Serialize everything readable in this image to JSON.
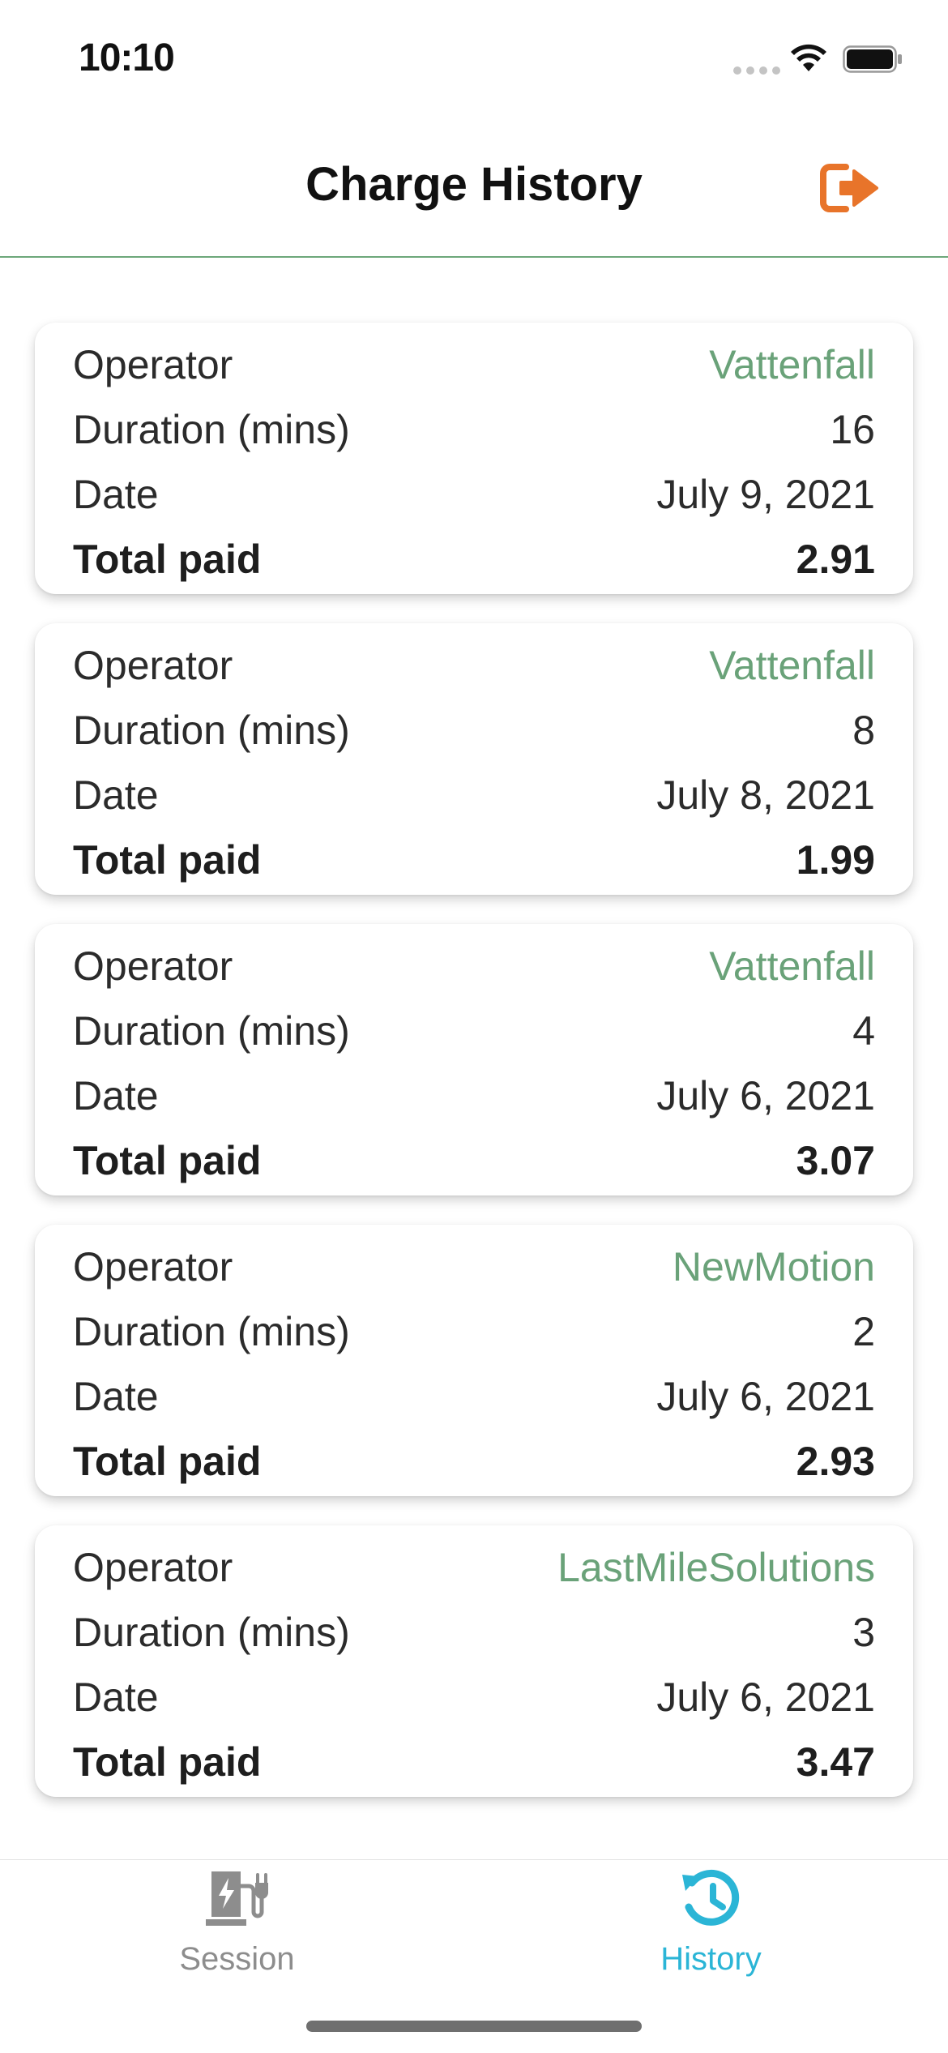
{
  "status_bar": {
    "time": "10:10"
  },
  "header": {
    "title": "Charge History",
    "logout_icon": "logout-icon",
    "accent_color": "#e8742a"
  },
  "labels": {
    "operator": "Operator",
    "duration": "Duration (mins)",
    "date": "Date",
    "total": "Total paid"
  },
  "sessions": [
    {
      "operator": "Vattenfall",
      "duration": "16",
      "date": "July 9, 2021",
      "total": "2.91"
    },
    {
      "operator": "Vattenfall",
      "duration": "8",
      "date": "July 8, 2021",
      "total": "1.99"
    },
    {
      "operator": "Vattenfall",
      "duration": "4",
      "date": "July 6, 2021",
      "total": "3.07"
    },
    {
      "operator": "NewMotion",
      "duration": "2",
      "date": "July 6, 2021",
      "total": "2.93"
    },
    {
      "operator": "LastMileSolutions",
      "duration": "3",
      "date": "July 6, 2021",
      "total": "3.47"
    }
  ],
  "tabs": [
    {
      "label": "Session",
      "icon": "ev-charger-icon",
      "active": false
    },
    {
      "label": "History",
      "icon": "history-icon",
      "active": true
    }
  ],
  "colors": {
    "operator_green": "#6aa279",
    "header_divider": "#6da77a",
    "tab_active": "#2bb5d6",
    "tab_inactive": "#8d8d8d"
  }
}
